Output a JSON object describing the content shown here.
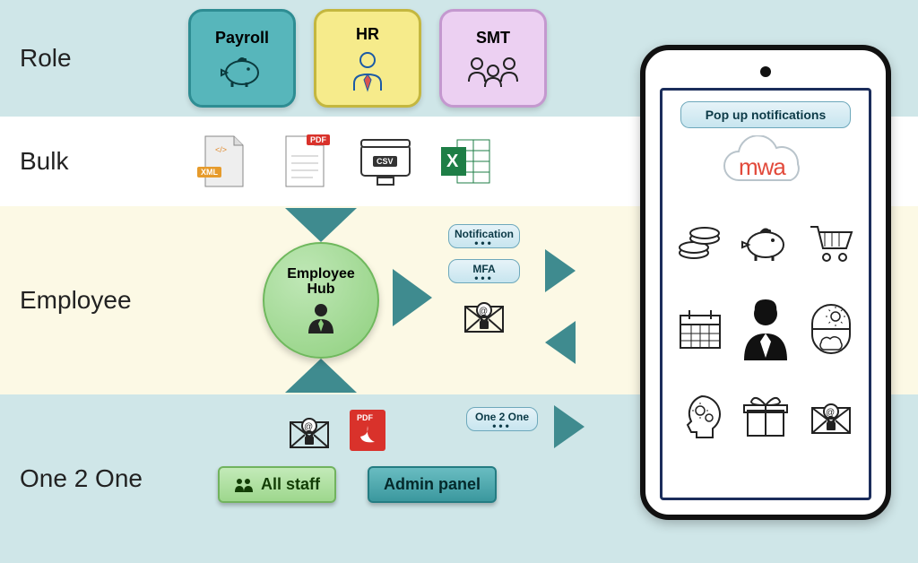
{
  "rows": {
    "role": "Role",
    "bulk": "Bulk",
    "employee": "Employee",
    "one2one": "One 2 One"
  },
  "role_boxes": {
    "payroll": "Payroll",
    "hr": "HR",
    "smt": "SMT"
  },
  "bulk_formats": {
    "xml": "XML",
    "pdf": "PDF",
    "csv": "CSV",
    "excel": "Excel"
  },
  "employee_hub": {
    "line1": "Employee",
    "line2": "Hub"
  },
  "chips": {
    "notification": "Notification",
    "mfa": "MFA",
    "one2one": "One 2 One"
  },
  "buttons": {
    "all_staff": "All staff",
    "admin_panel": "Admin panel"
  },
  "phone": {
    "notif": "Pop up notifications",
    "brand": "mwa"
  },
  "colors": {
    "teal": "#3f8b8f",
    "pale_teal": "#cfe6e8",
    "pale_yellow": "#fcf9e5",
    "hub_green": "#8fd07e"
  }
}
